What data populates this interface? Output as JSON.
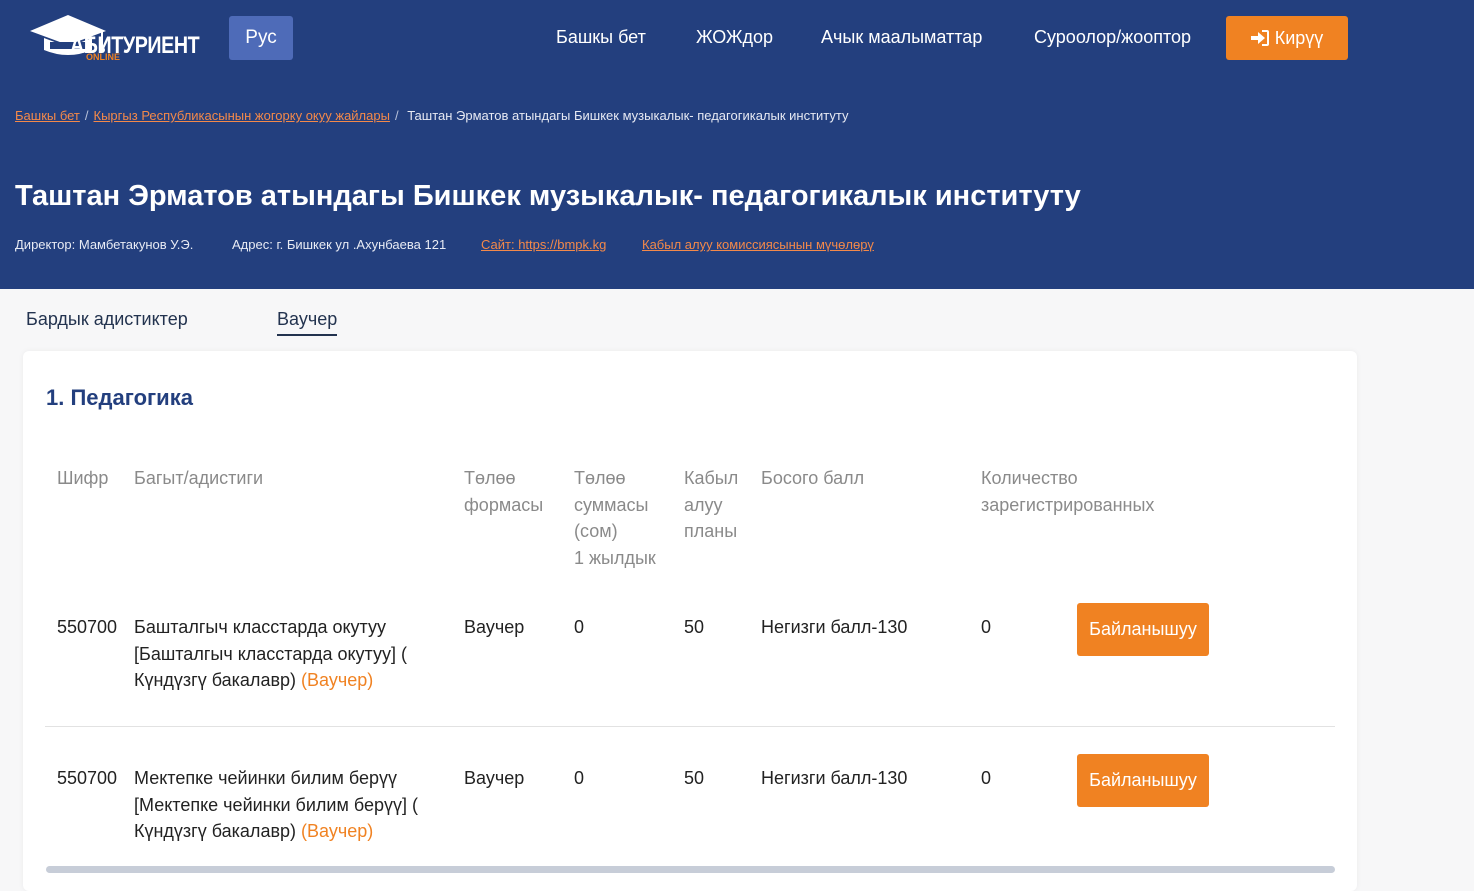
{
  "header": {
    "logo_text": "АБИТУРИЕНТ",
    "logo_sub": "ONLINE",
    "lang_button": "Рус",
    "nav": [
      "Башкы бет",
      "ЖОЖдор",
      "Ачык маалыматтар",
      "Суроолор/жооптор"
    ],
    "login_button": "Кирүү"
  },
  "breadcrumb": {
    "home": "Башкы бет",
    "universities": "Кыргыз Республикасынын жогорку окуу жайлары",
    "current": "Таштан Эрматов атындагы Бишкек музыкалык- педагогикалык институту"
  },
  "institution": {
    "title": "Таштан Эрматов атындагы Бишкек музыкалык- педагогикалык институту",
    "director": "Директор: Мамбетакунов У.Э.",
    "address": "Адрес: г. Бишкек ул .Ахунбаева 121",
    "site": "Сайт: https://bmpk.kg",
    "commission": "Кабыл алуу комиссиясынын мүчөлөрү"
  },
  "tabs": {
    "all": "Бардык адистиктер",
    "voucher": "Ваучер"
  },
  "section": {
    "title": "1. Педагогика",
    "columns": {
      "code": "Шифр",
      "program": "Багыт/адистиги",
      "payment_form": "Төлөө формасы",
      "payment_amount": "Төлөө суммасы (сом)",
      "payment_period": "1 жылдык",
      "plan": "Кабыл алуу планы",
      "threshold": "Босого балл",
      "registered": "Количество зарегистрированных"
    },
    "rows": [
      {
        "code": "550700",
        "program_line1": "Башталгыч класстарда окутуу",
        "program_line2": "[Башталгыч класстарда окутуу] (",
        "program_line3": "Күндүзгү бакалавр)",
        "program_tag": "(Ваучер)",
        "payment_form": "Ваучер",
        "payment_amount": "0",
        "plan": "50",
        "threshold": "Негизги балл-130",
        "registered": "0",
        "button": "Байланышуу"
      },
      {
        "code": "550700",
        "program_line1": "Мектепке чейинки билим берүү",
        "program_line2": "[Мектепке чейинки билим берүү] (",
        "program_line3": "Күндүзгү бакалавр)",
        "program_tag": "(Ваучер)",
        "payment_form": "Ваучер",
        "payment_amount": "0",
        "plan": "50",
        "threshold": "Негизги балл-130",
        "registered": "0",
        "button": "Байланышуу"
      }
    ]
  },
  "colors": {
    "header_bg": "#233f7e",
    "accent": "#f08222",
    "lang_bg": "#4e6bb8"
  }
}
